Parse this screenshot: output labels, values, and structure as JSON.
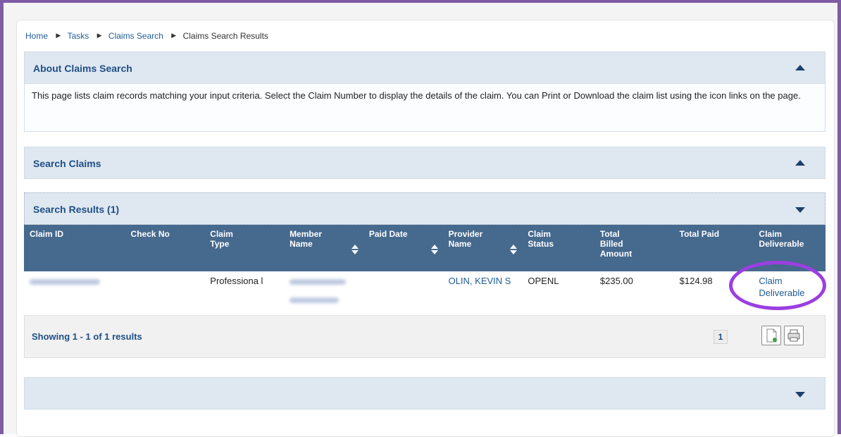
{
  "breadcrumb": {
    "items": [
      "Home",
      "Tasks",
      "Claims Search"
    ],
    "current": "Claims Search Results"
  },
  "about_panel": {
    "title": "About Claims Search",
    "description": "This page lists claim records matching your input criteria. Select the Claim Number to display the details of the claim. You can Print or Download the claim list using the icon links on the page."
  },
  "search_panel": {
    "title": "Search Claims"
  },
  "results_panel": {
    "title": "Search Results (1)",
    "columns": [
      {
        "label": "Claim ID",
        "sortable": false
      },
      {
        "label": "Check No",
        "sortable": false
      },
      {
        "label": "Claim Type",
        "sortable": false
      },
      {
        "label": "Member Name",
        "sortable": true
      },
      {
        "label": "Paid Date",
        "sortable": true
      },
      {
        "label": "Provider Name",
        "sortable": true
      },
      {
        "label": "Claim Status",
        "sortable": false
      },
      {
        "label": "Total Billed Amount",
        "sortable": false
      },
      {
        "label": "Total Paid",
        "sortable": false
      },
      {
        "label": "Claim Deliverable",
        "sortable": false
      }
    ],
    "rows": [
      {
        "claim_type": "Professiona l",
        "provider_name": "OLIN, KEVIN S",
        "claim_status": "OPENL",
        "total_billed": "$235.00",
        "total_paid": "$124.98",
        "claim_deliverable": "Claim Deliverable"
      }
    ],
    "showing": "Showing 1 - 1 of 1 results",
    "page_number": "1"
  },
  "icons": {
    "collapse": "chevron-up-icon",
    "expand": "chevron-down-icon",
    "download": "download-icon",
    "print": "print-icon",
    "sort": "sort-icon"
  },
  "colors": {
    "frame_accent": "#7f5aa5",
    "header_bg": "#dfe8f1",
    "table_header_bg": "#46698e",
    "link": "#1f5c96",
    "highlight": "#9b3fe0"
  }
}
